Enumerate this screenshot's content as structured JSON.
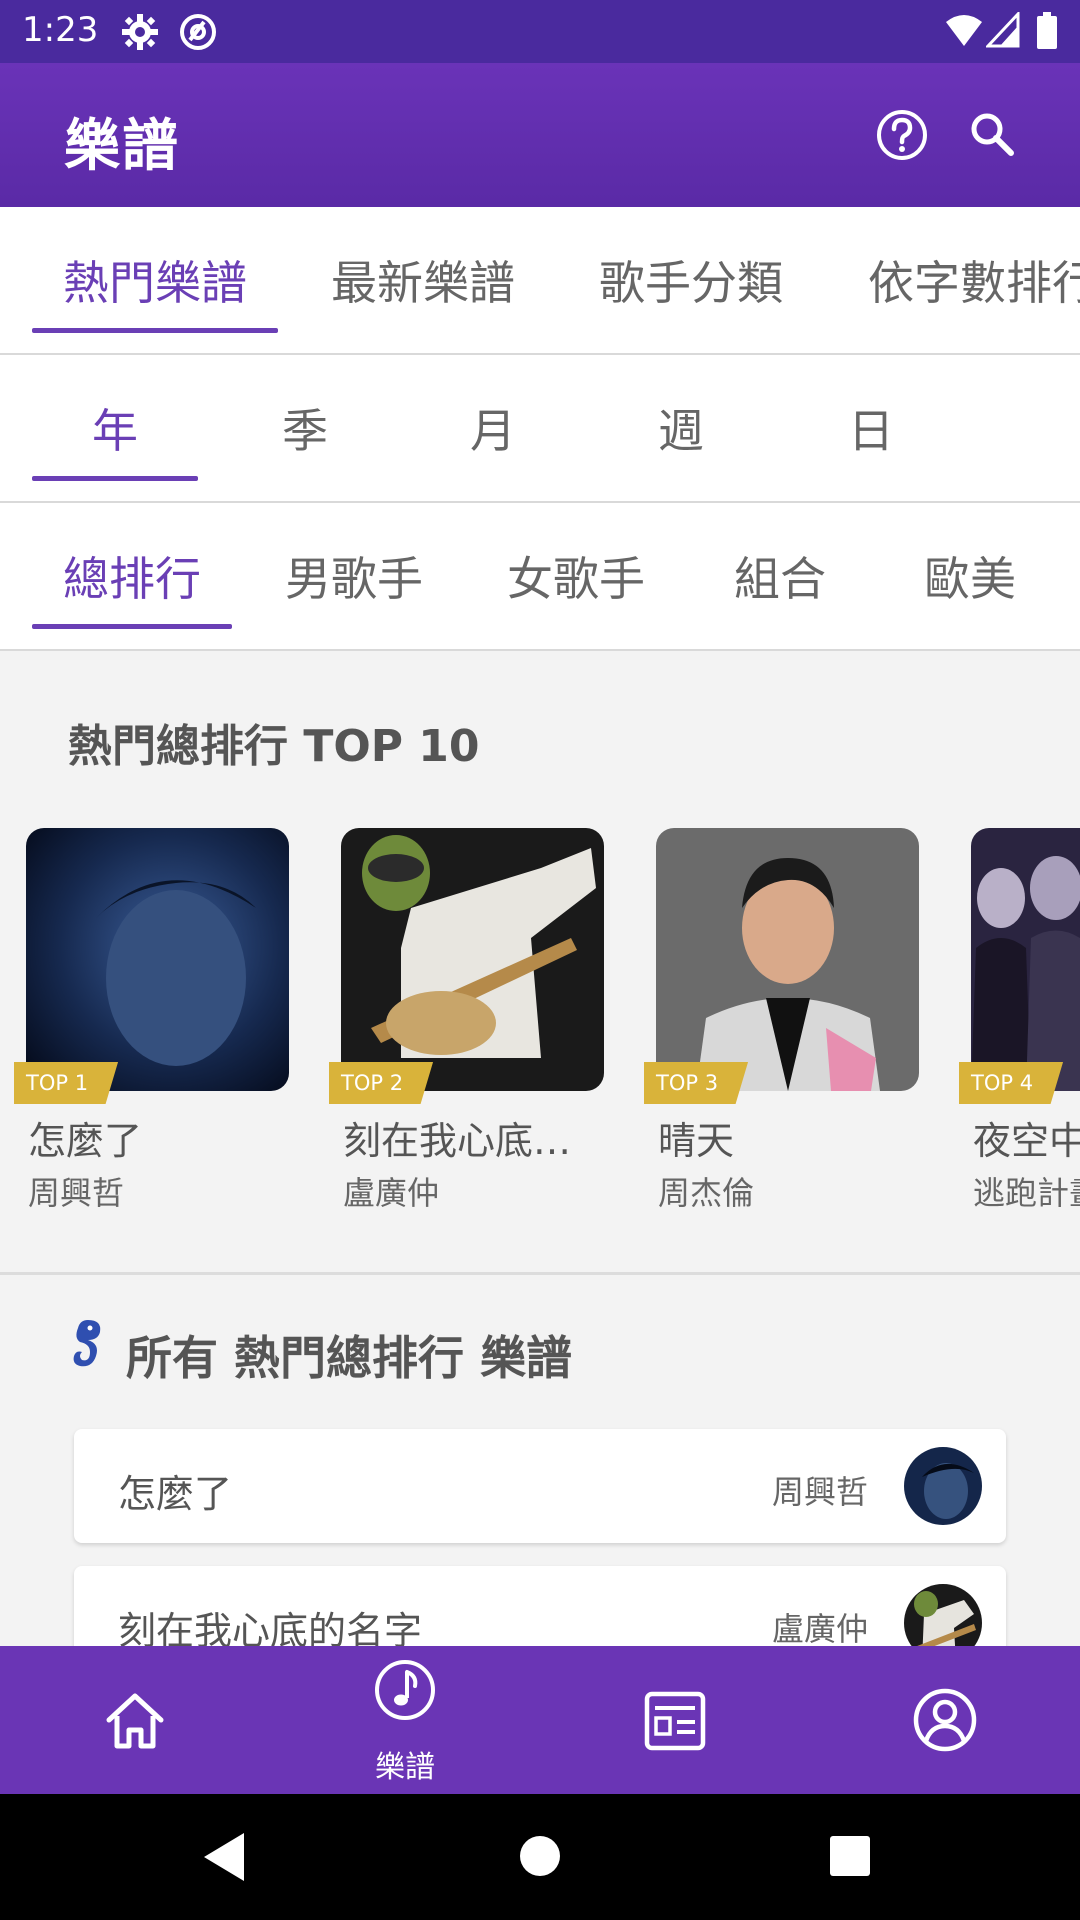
{
  "status_bar": {
    "time": "1:23"
  },
  "app_bar": {
    "title": "樂譜"
  },
  "category_tabs": [
    {
      "label": "熱門樂譜",
      "active": true
    },
    {
      "label": "最新樂譜",
      "active": false
    },
    {
      "label": "歌手分類",
      "active": false
    },
    {
      "label": "依字數排行",
      "active": false
    }
  ],
  "period_tabs": [
    {
      "label": "年",
      "active": true
    },
    {
      "label": "季",
      "active": false
    },
    {
      "label": "月",
      "active": false
    },
    {
      "label": "週",
      "active": false
    },
    {
      "label": "日",
      "active": false
    }
  ],
  "ranking_tabs": [
    {
      "label": "總排行",
      "active": true
    },
    {
      "label": "男歌手",
      "active": false
    },
    {
      "label": "女歌手",
      "active": false
    },
    {
      "label": "組合",
      "active": false
    },
    {
      "label": "歐美",
      "active": false
    }
  ],
  "top10": {
    "title": "熱門總排行 TOP 10",
    "items": [
      {
        "rank": "TOP 1",
        "song": "怎麼了",
        "artist": "周興哲"
      },
      {
        "rank": "TOP 2",
        "song": "刻在我心底的…",
        "artist": "盧廣仲"
      },
      {
        "rank": "TOP 3",
        "song": "晴天",
        "artist": "周杰倫"
      },
      {
        "rank": "TOP 4",
        "song": "夜空中",
        "artist": "逃跑計畫"
      }
    ]
  },
  "all_list": {
    "title": "所有 熱門總排行 樂譜",
    "rows": [
      {
        "song": "怎麼了",
        "artist": "周興哲"
      },
      {
        "song": "刻在我心底的名字",
        "artist": "盧廣仲"
      }
    ]
  },
  "bottom_nav": [
    {
      "icon": "home-icon",
      "label": ""
    },
    {
      "icon": "music-note-icon",
      "label": "樂譜"
    },
    {
      "icon": "news-icon",
      "label": ""
    },
    {
      "icon": "profile-icon",
      "label": ""
    }
  ],
  "colors": {
    "status_bar": "#4a2a9e",
    "app_bar": "#6a33b8",
    "accent": "#6a3fb5",
    "ribbon": "#d9b33a",
    "bottom_nav": "#6a35b5"
  }
}
